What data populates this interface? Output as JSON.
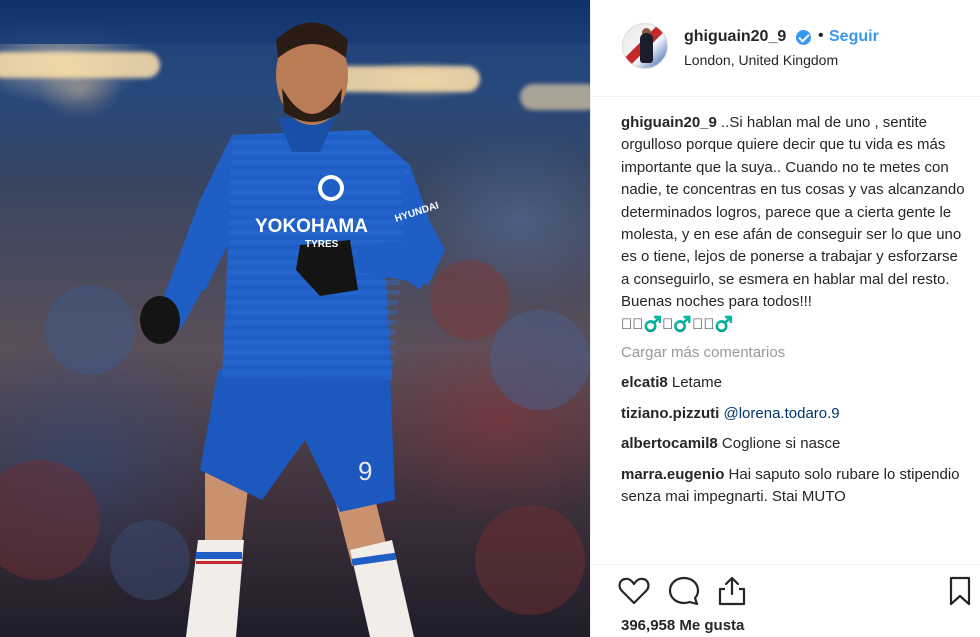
{
  "post": {
    "author": {
      "username": "ghiguain20_9",
      "location": "London, United Kingdom",
      "follow_label": "Seguir",
      "separator": "•"
    },
    "photo": {
      "shirt_sponsor": "YOKOHAMA",
      "shirt_sponsor_sub": "TYRES",
      "sleeve_sponsor": "HYUNDAI",
      "jersey_number": "9"
    },
    "caption": {
      "username": "ghiguain20_9",
      "text": "..Si hablan mal de uno , sentite orgulloso porque quiere decir que tu vida es más importante que la suya.. Cuando no te metes con nadie, te concentras en tus cosas y vas alcanzando determinados logros, parece que a cierta gente le molesta, y en ese afán de conseguir ser lo que uno es o tiene, lejos de ponerse a trabajar y esforzarse a conseguirlo, se esmera en hablar mal del resto.\nBuenas noches para todos!!!",
      "emoji_line": "􀀀􀀀♂️􀀀♂️􀀀􀀀♂️"
    },
    "load_more_label": "Cargar más comentarios",
    "comments": [
      {
        "username": "elcati8",
        "text": "Letame",
        "mention": ""
      },
      {
        "username": "tiziano.pizzuti",
        "text": "",
        "mention": "@lorena.todaro.9"
      },
      {
        "username": "albertocamil8",
        "text": "Coglione si nasce",
        "mention": ""
      },
      {
        "username": "marra.eugenio",
        "text": "Hai saputo solo rubare lo stipendio senza mai impegnarti. Stai MUTO",
        "mention": ""
      }
    ],
    "likes_label": "396,958 Me gusta",
    "icons": {
      "like": "heart-icon",
      "comment": "comment-bubble-icon",
      "share": "share-icon",
      "save": "bookmark-icon",
      "verified": "verified-badge-icon"
    },
    "colors": {
      "accent": "#3897f0",
      "text": "#262626",
      "muted": "#999999",
      "mention": "#003569",
      "jersey": "#1f5fc5"
    }
  }
}
